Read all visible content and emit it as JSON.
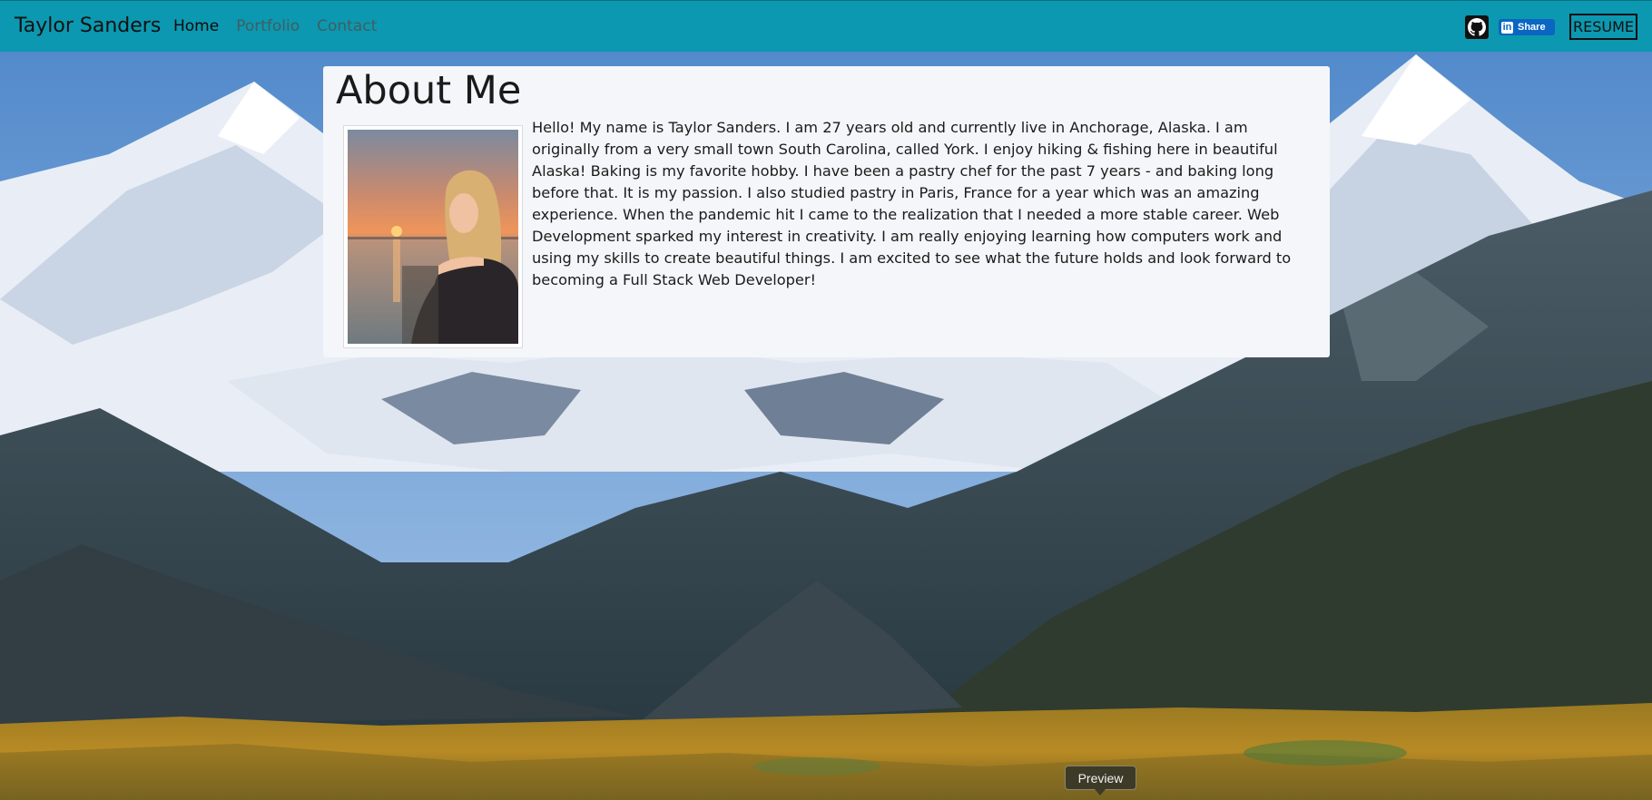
{
  "nav": {
    "brand": "Taylor Sanders",
    "links": [
      {
        "label": "Home",
        "active": true
      },
      {
        "label": "Portfolio",
        "active": false
      },
      {
        "label": "Contact",
        "active": false
      }
    ],
    "github_icon": "github-icon",
    "linkedin_icon": "linkedin-icon",
    "linkedin_share_label": "Share",
    "resume_label": "RESUME"
  },
  "about": {
    "title": "About Me",
    "bio": "Hello! My name is Taylor Sanders. I am 27 years old and currently live in Anchorage, Alaska. I am originally from a very small town South Carolina, called York. I enjoy hiking & fishing here in beautiful Alaska! Baking is my favorite hobby. I have been a pastry chef for the past 7 years - and baking long before that. It is my passion. I also studied pastry in Paris, France for a year which was an amazing experience. When the pandemic hit I came to the realization that I needed a more stable career. Web Development sparked my interest in creativity. I am really enjoying learning how computers work and using my skills to create beautiful things. I am excited to see what the future holds and look forward to becoming a Full Stack Web Developer!"
  },
  "tooltip": {
    "label": "Preview"
  },
  "colors": {
    "navbar": "#0c98b0",
    "card": "#f4f6f9",
    "linkedin": "#0a66c2"
  }
}
